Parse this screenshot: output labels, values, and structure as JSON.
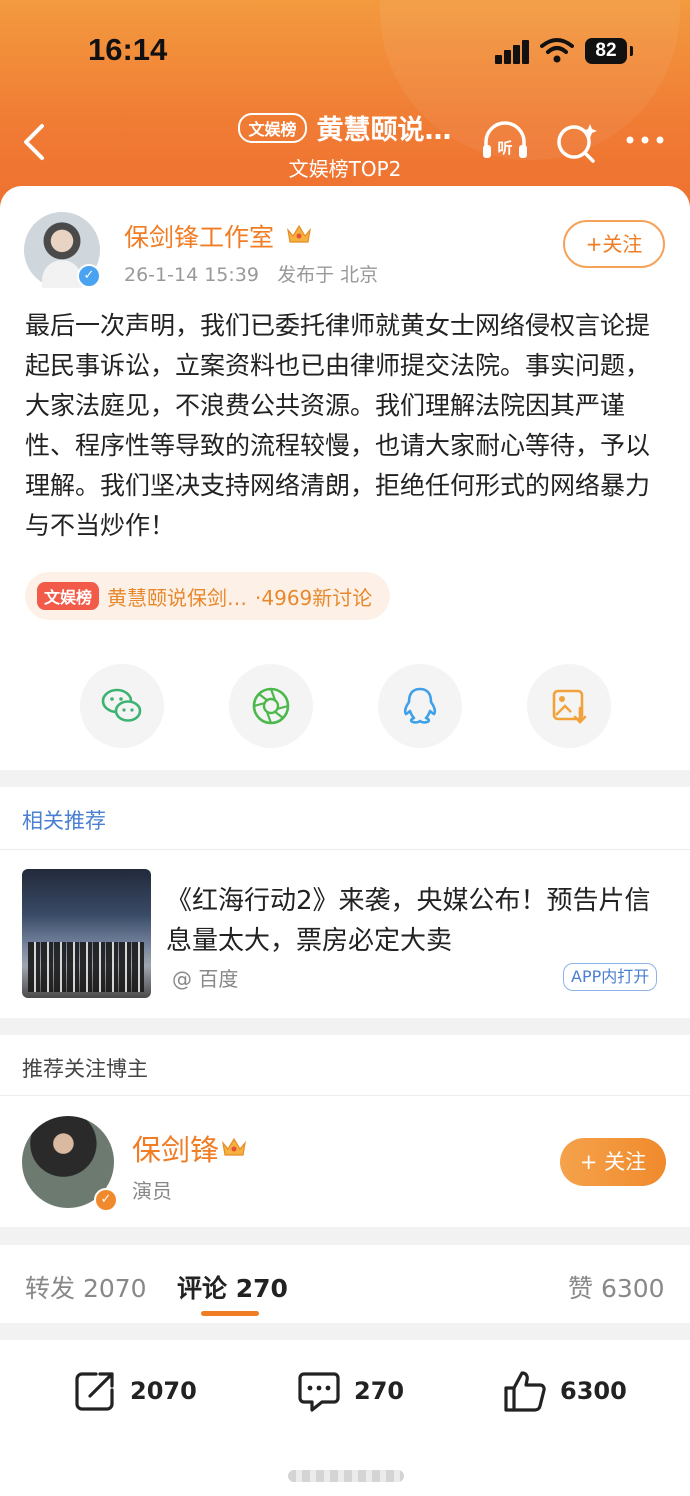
{
  "status_bar": {
    "time": "16:14",
    "battery": "82"
  },
  "header": {
    "tag": "文娱榜",
    "title": "黄慧颐说…",
    "subtitle": "文娱榜TOP2"
  },
  "post": {
    "author": "保剑锋工作室",
    "time": "26-1-14 15:39",
    "location": "发布于 北京",
    "follow_label": "+关注",
    "body": "最后一次声明，我们已委托律师就黄女士网络侵权言论提起民事诉讼，立案资料也已由律师提交法院。事实问题，大家法庭见，不浪费公共资源。我们理解法院因其严谨性、程序性等导致的流程较慢，也请大家耐心等待，予以理解。我们坚决支持网络清朗，拒绝任何形式的网络暴力与不当炒作！",
    "topic_tag": "文娱榜",
    "topic_text": "黄慧颐说保剑…",
    "topic_count": "·4969新讨论",
    "share_icons": [
      "wechat-icon",
      "moments-icon",
      "qq-icon",
      "save-image-icon"
    ]
  },
  "recommend": {
    "section_title": "相关推荐",
    "title": "《红海行动2》来袭，央媒公布！预告片信息量太大，票房必定大卖",
    "source": "@ 百度",
    "open_app_label": "APP内打开"
  },
  "blogger": {
    "section_title": "推荐关注博主",
    "name": "保剑锋",
    "role": "演员",
    "follow_label": "+ 关注"
  },
  "tabs": {
    "repost_label": "转发",
    "repost_count": "2070",
    "comment_label": "评论",
    "comment_count": "270",
    "like_label": "赞",
    "like_count": "6300"
  },
  "actions": {
    "repost": "2070",
    "comment": "270",
    "like": "6300"
  },
  "colors": {
    "accent": "#f07c24",
    "header_top": "#f39a3f",
    "header_bottom": "#ee6f2f",
    "link_blue": "#4a7fd1"
  }
}
